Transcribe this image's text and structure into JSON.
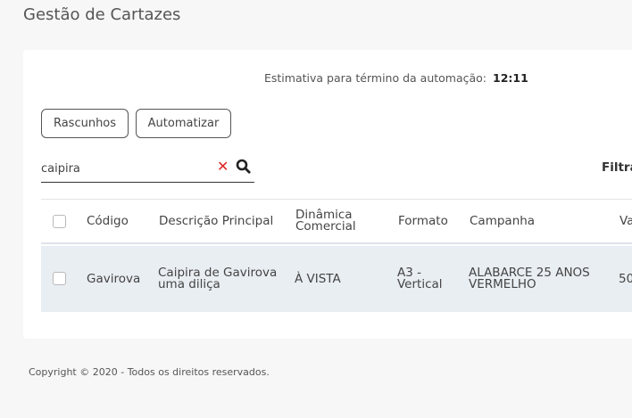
{
  "page": {
    "title": "Gestão de Cartazes"
  },
  "automation": {
    "estimate_label": "Estimativa para término da automação:",
    "estimate_time": "12:11"
  },
  "toolbar": {
    "drafts_label": "Rascunhos",
    "automate_label": "Automatizar"
  },
  "search": {
    "value": "caipira",
    "placeholder": ""
  },
  "filters": {
    "label": "Filtrar"
  },
  "table": {
    "headers": {
      "code": "Código",
      "description": "Descrição Principal",
      "dynamic_line1": "Dinâmica",
      "dynamic_line2": "Comercial",
      "format": "Formato",
      "campaign": "Campanha",
      "value": "Va"
    },
    "rows": [
      {
        "code": "Gavirova",
        "description_line1": "Caipira de Gavirova",
        "description_line2": "uma diliça",
        "dynamic": "À VISTA",
        "format_line1": "A3 -",
        "format_line2": "Vertical",
        "campaign_line1": "ALABARCE 25 ANOS",
        "campaign_line2": "VERMELHO",
        "value": "50"
      }
    ]
  },
  "footer": {
    "copyright": "Copyright © 2020 - Todos os direitos reservados."
  },
  "colors": {
    "clear_icon": "#e02424",
    "row_background": "#e9eef3",
    "page_background": "#f7f7f7"
  }
}
